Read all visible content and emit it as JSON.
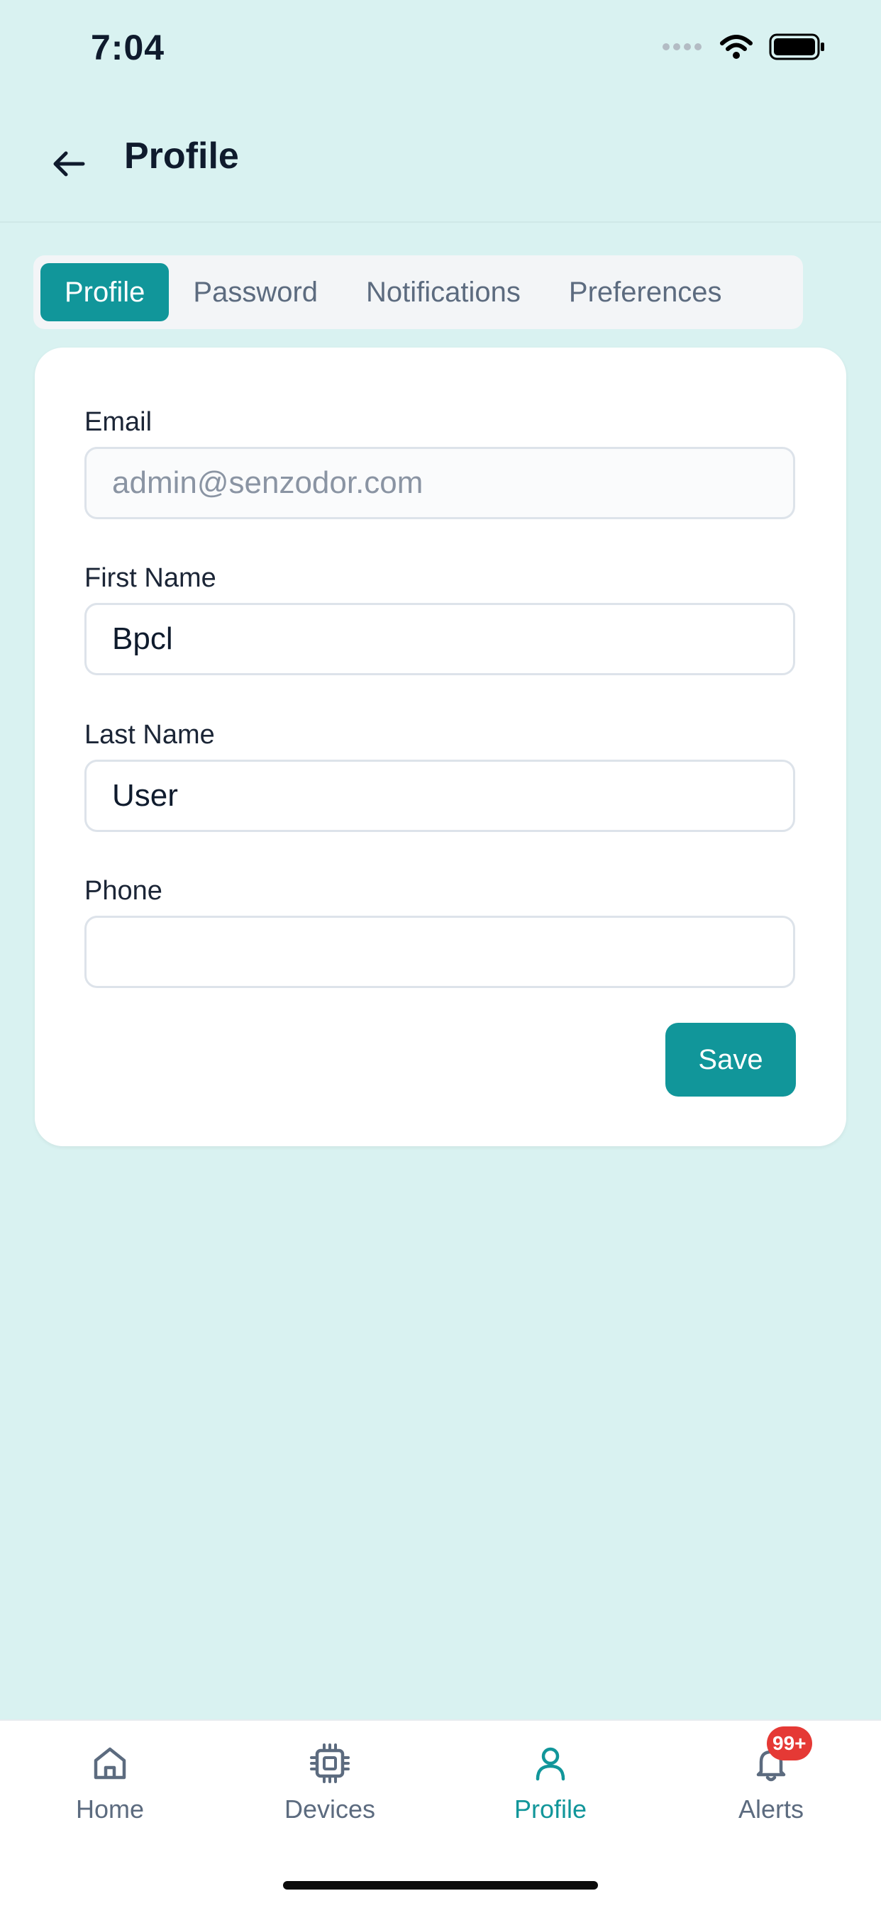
{
  "status_bar": {
    "time": "7:04",
    "icons": [
      "signal-dots-icon",
      "wifi-icon",
      "battery-icon"
    ]
  },
  "header": {
    "title": "Profile",
    "back_icon": "arrow-left-icon"
  },
  "tabs": [
    {
      "label": "Profile",
      "active": true
    },
    {
      "label": "Password",
      "active": false
    },
    {
      "label": "Notifications",
      "active": false
    },
    {
      "label": "Preferences",
      "active": false
    }
  ],
  "form": {
    "email": {
      "label": "Email",
      "value": "admin@senzodor.com",
      "disabled": true
    },
    "first_name": {
      "label": "First Name",
      "value": "Bpcl"
    },
    "last_name": {
      "label": "Last Name",
      "value": "User"
    },
    "phone": {
      "label": "Phone",
      "value": ""
    },
    "save_label": "Save"
  },
  "bottom_nav": {
    "items": [
      {
        "label": "Home",
        "icon": "home-icon",
        "active": false
      },
      {
        "label": "Devices",
        "icon": "chip-icon",
        "active": false
      },
      {
        "label": "Profile",
        "icon": "user-icon",
        "active": true
      },
      {
        "label": "Alerts",
        "icon": "bell-icon",
        "active": false,
        "badge": "99+"
      }
    ]
  },
  "colors": {
    "background": "#d9f2f1",
    "accent": "#11969a",
    "badge": "#e53935"
  }
}
